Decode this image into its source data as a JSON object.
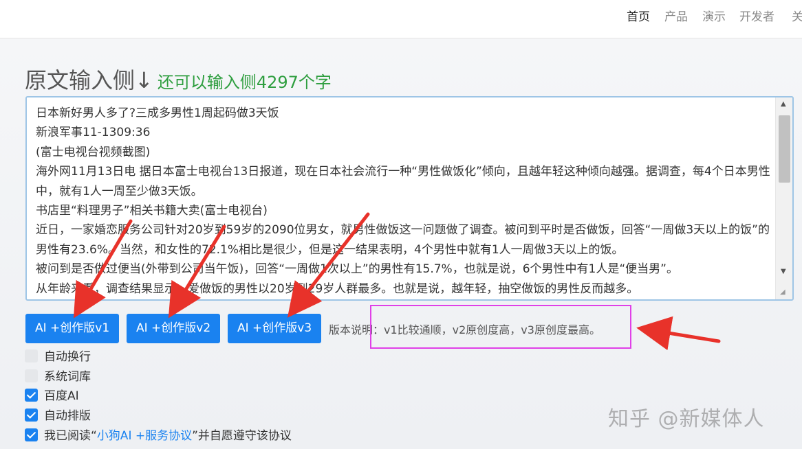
{
  "nav": {
    "items": [
      "首页",
      "产品",
      "演示",
      "开发者",
      "关"
    ]
  },
  "heading": {
    "title": "原文输入侧↓",
    "counter": "还可以输入侧4297个字"
  },
  "editor": {
    "text": "日本新好男人多了?三成多男性1周起码做3天饭\n新浪军事11-1309:36\n(富士电视台视频截图)\n海外网11月13日电 据日本富士电视台13日报道，现在日本社会流行一种“男性做饭化”倾向，且越年轻这种倾向越强。据调查，每4个日本男性中，就有1人一周至少做3天饭。\n书店里“料理男子”相关书籍大卖(富士电视台)\n近日，一家婚恋服务公司针对20岁到59岁的2090位男女，就男性做饭这一问题做了调查。被问到平时是否做饭，回答“一周做3天以上的饭”的男性有23.6%。当然，和女性的72.1%相比是很少，但是这一结果表明，4个男性中就有1人一周做3天以上的饭。\n被问到是否做过便当(外带到公司当午饭)，回答“一周做1次以上”的男性有15.7%，也就是说，6个男性中有1人是“便当男”。\n从年龄来看，调查结果显示，爱做饭的男性以20岁到29岁人群最多。也就是说，越年轻，抽空做饭的男性反而越多。"
  },
  "buttons": {
    "v1": "AI +创作版v1",
    "v2": "AI +创作版v2",
    "v3": "AI +创作版v3"
  },
  "version_note": "版本说明：v1比较通顺，v2原创度高，v3原创度最高。",
  "options": {
    "auto_wrap": "自动换行",
    "system_lexicon": "系统词库",
    "baidu_ai": "百度AI",
    "auto_layout": "自动排版",
    "agree_prefix": "我已阅读“",
    "agree_link": "小狗AI +服务协议",
    "agree_suffix": "”并自愿遵守该协议"
  },
  "option_states": {
    "auto_wrap": false,
    "system_lexicon": false,
    "baidu_ai": true,
    "auto_layout": true,
    "agree": true
  },
  "watermark": "知乎 @新媒体人",
  "colors": {
    "accent": "#1a82f0",
    "counter_green": "#2e9e3f",
    "annotation_red": "#e8322a",
    "highlight_magenta": "#e040e8"
  }
}
